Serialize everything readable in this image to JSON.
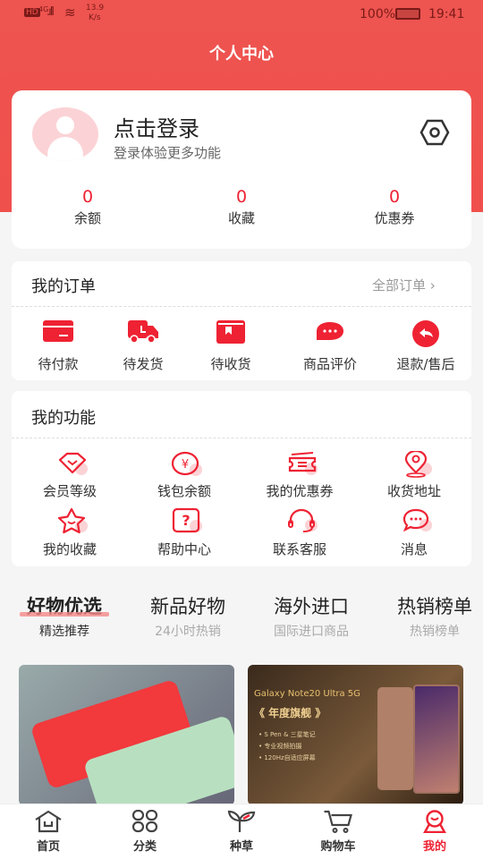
{
  "status": {
    "network": "4G",
    "speed": "13.9",
    "speed_unit": "K/s",
    "battery": "100%",
    "time": "19:41"
  },
  "header": {
    "title": "个人中心"
  },
  "profile": {
    "login": "点击登录",
    "subtitle": "登录体验更多功能",
    "stats": [
      {
        "value": "0",
        "label": "余额"
      },
      {
        "value": "0",
        "label": "收藏"
      },
      {
        "value": "0",
        "label": "优惠券"
      }
    ]
  },
  "orders": {
    "title": "我的订单",
    "all": "全部订单",
    "items": [
      {
        "label": "待付款",
        "icon": "card-icon"
      },
      {
        "label": "待发货",
        "icon": "truck-icon"
      },
      {
        "label": "待收货",
        "icon": "box-icon"
      },
      {
        "label": "商品评价",
        "icon": "comment-icon"
      },
      {
        "label": "退款/售后",
        "icon": "return-icon"
      }
    ]
  },
  "functions": {
    "title": "我的功能",
    "items": [
      {
        "label": "会员等级",
        "icon": "diamond-icon"
      },
      {
        "label": "钱包余额",
        "icon": "wallet-icon"
      },
      {
        "label": "我的优惠券",
        "icon": "coupon-icon"
      },
      {
        "label": "收货地址",
        "icon": "location-icon"
      },
      {
        "label": "我的收藏",
        "icon": "star-icon"
      },
      {
        "label": "帮助中心",
        "icon": "help-icon"
      },
      {
        "label": "联系客服",
        "icon": "headset-icon"
      },
      {
        "label": "消息",
        "icon": "message-icon"
      }
    ]
  },
  "tabs": [
    {
      "title": "好物优选",
      "sub": "精选推荐"
    },
    {
      "title": "新品好物",
      "sub": "24小时热销"
    },
    {
      "title": "海外进口",
      "sub": "国际进口商品"
    },
    {
      "title": "热销榜单",
      "sub": "热销榜单"
    }
  ],
  "products": [
    {
      "banner": ""
    },
    {
      "banner": "Galaxy Note20 Ultra 5G",
      "tag": "《 年度旗舰 》",
      "bullets": [
        "• S Pen & 三星笔记",
        "• 专业视频拍摄",
        "• 120Hz自适应屏幕"
      ]
    }
  ],
  "nav": [
    {
      "label": "首页",
      "icon": "home-icon"
    },
    {
      "label": "分类",
      "icon": "category-icon"
    },
    {
      "label": "种草",
      "icon": "sprout-icon"
    },
    {
      "label": "购物车",
      "icon": "cart-icon"
    },
    {
      "label": "我的",
      "icon": "profile-icon"
    }
  ],
  "colors": {
    "accent": "#f0504c",
    "icon_red": "#ee2233",
    "active_nav": "#ee2233"
  }
}
